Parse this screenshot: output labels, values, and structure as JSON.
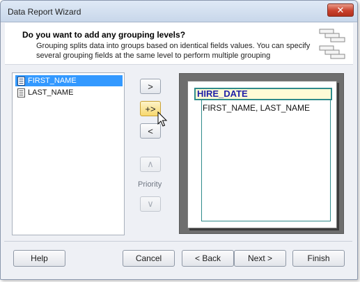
{
  "window": {
    "title": "Data Report Wizard",
    "close_glyph": "✕"
  },
  "header": {
    "title": "Do you want to add any grouping levels?",
    "description": "Grouping splits data into groups based on identical fields values. You can specify several grouping fields at the same level to perform multiple grouping"
  },
  "fields_list": {
    "items": [
      {
        "label": "FIRST_NAME",
        "selected": true
      },
      {
        "label": "LAST_NAME",
        "selected": false
      }
    ]
  },
  "move_buttons": {
    "add": ">",
    "add_to_group": "+>",
    "remove": "<"
  },
  "priority": {
    "label": "Priority",
    "up": "∧",
    "down": "∨"
  },
  "preview": {
    "group_field": "HIRE_DATE",
    "detail_fields": "FIRST_NAME, LAST_NAME"
  },
  "footer": {
    "help": "Help",
    "cancel": "Cancel",
    "back": "< Back",
    "next": "Next >",
    "finish": "Finish"
  },
  "colors": {
    "selection": "#3399ff",
    "group_border": "#2f8b8b",
    "group_text": "#1f1fa8",
    "group_fill": "#fffbd6",
    "hot_button": "#f7d86e"
  }
}
